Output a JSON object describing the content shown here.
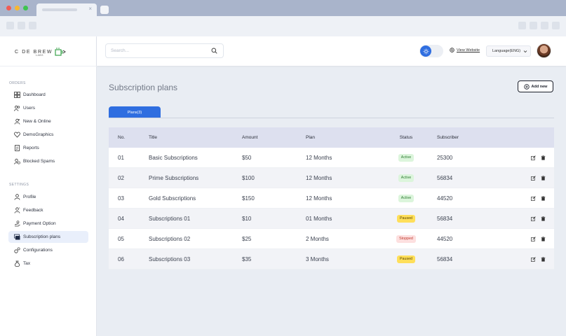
{
  "colors": {
    "accent": "#2f6ee0",
    "active": "#2e7d32",
    "paused": "#ffdf5a",
    "stopped": "#c0392b"
  },
  "brand": {
    "name": "C  DE BREW",
    "sub": "LABS"
  },
  "sidebar": {
    "sections": [
      {
        "title": "ORDERS",
        "items": [
          {
            "label": "Dashboard",
            "icon": "dashboard-icon"
          },
          {
            "label": "Users",
            "icon": "users-icon"
          },
          {
            "label": "New & Online",
            "icon": "new-online-icon"
          },
          {
            "label": "DemoGraphics",
            "icon": "heart-icon"
          },
          {
            "label": "Reports",
            "icon": "reports-icon"
          },
          {
            "label": "Blocked Spams",
            "icon": "blocked-icon"
          }
        ]
      },
      {
        "title": "SETTINGS",
        "items": [
          {
            "label": "Profile",
            "icon": "profile-icon"
          },
          {
            "label": "Feedback",
            "icon": "feedback-icon"
          },
          {
            "label": "Payment Option",
            "icon": "payment-icon"
          },
          {
            "label": "Subscription plans",
            "icon": "subscription-icon",
            "active": true
          },
          {
            "label": "Configurations",
            "icon": "config-icon"
          },
          {
            "label": "Tax",
            "icon": "tax-icon"
          }
        ]
      }
    ]
  },
  "header": {
    "search_placeholder": "Search...",
    "view_website": "View Website",
    "language": "Language(ENG)"
  },
  "main": {
    "title": "Subscription plans",
    "add_new": "Add new",
    "tab_label": "Plans(3)",
    "columns": [
      "No.",
      "Title",
      "Amount",
      "Plan",
      "Status",
      "Subscriber"
    ],
    "rows": [
      {
        "no": "01",
        "title": "Basic Subscriptions",
        "amount": "$50",
        "plan": "12 Months",
        "status": "Active",
        "subscriber": "25300"
      },
      {
        "no": "02",
        "title": "Prime Subscriptions",
        "amount": "$100",
        "plan": "12 Months",
        "status": "Active",
        "subscriber": "56834"
      },
      {
        "no": "03",
        "title": "Gold Subscriptions",
        "amount": "$150",
        "plan": "12 Months",
        "status": "Active",
        "subscriber": "44520"
      },
      {
        "no": "04",
        "title": "Subscriptions 01",
        "amount": "$10",
        "plan": "01 Months",
        "status": "Paused",
        "subscriber": "56834"
      },
      {
        "no": "05",
        "title": "Subscriptions 02",
        "amount": "$25",
        "plan": "2 Months",
        "status": "Stopped",
        "subscriber": "44520"
      },
      {
        "no": "06",
        "title": "Subscriptions 03",
        "amount": "$35",
        "plan": "3 Months",
        "status": "Paused",
        "subscriber": "56834"
      }
    ]
  }
}
